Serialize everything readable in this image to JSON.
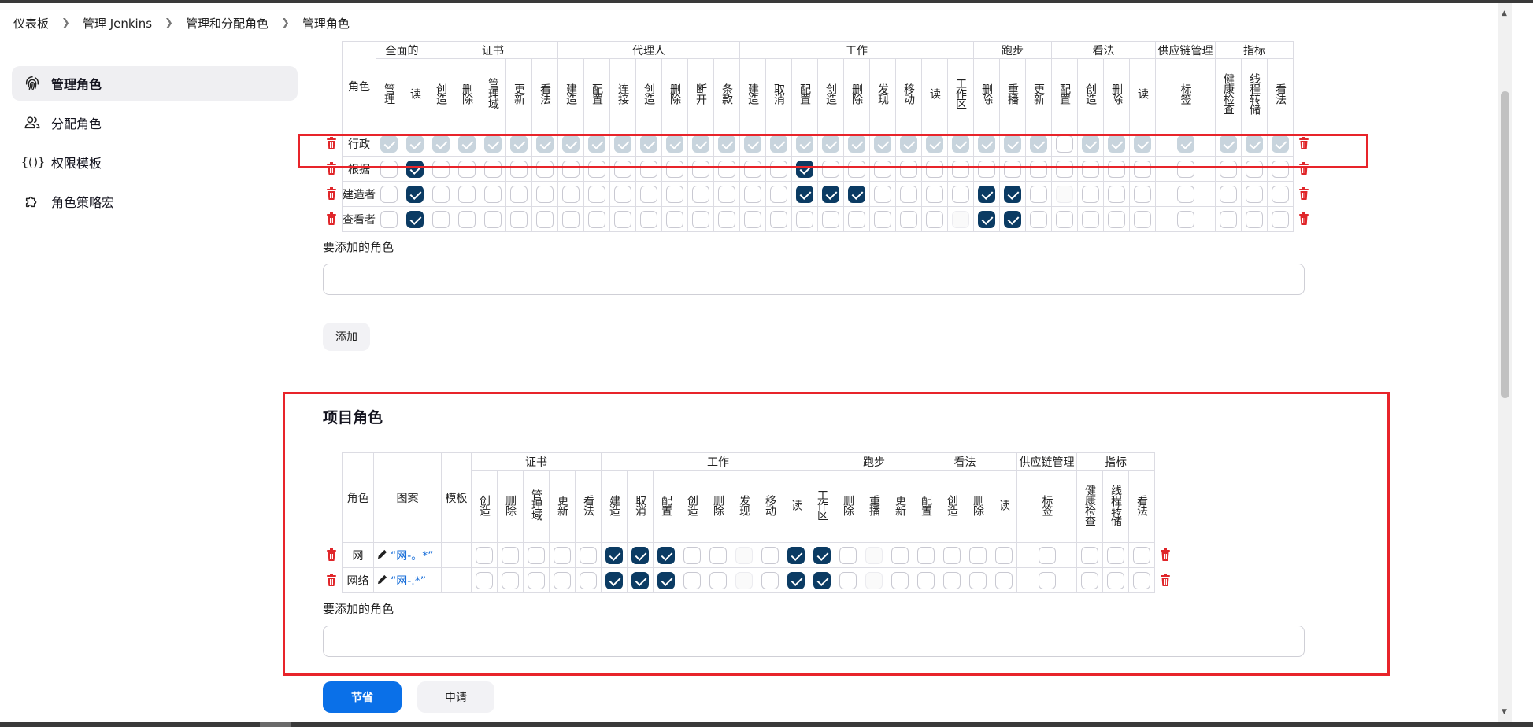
{
  "breadcrumb": [
    "仪表板",
    "管理 Jenkins",
    "管理和分配角色",
    "管理角色"
  ],
  "sidebar": {
    "items": [
      {
        "label": "管理角色",
        "icon": "fingerprint-icon",
        "active": true
      },
      {
        "label": "分配角色",
        "icon": "users-icon",
        "active": false
      },
      {
        "label": "权限模板",
        "icon": "braces-icon",
        "active": false
      },
      {
        "label": "角色策略宏",
        "icon": "puzzle-icon",
        "active": false
      }
    ]
  },
  "global": {
    "role_header": "角色",
    "groups": [
      {
        "name": "全面的",
        "perms": [
          "管理",
          "读"
        ]
      },
      {
        "name": "证书",
        "perms": [
          "创造",
          "删除",
          "管理域",
          "更新",
          "看法"
        ]
      },
      {
        "name": "代理人",
        "perms": [
          "建造",
          "配置",
          "连接",
          "创造",
          "删除",
          "断开",
          "条款"
        ]
      },
      {
        "name": "工作",
        "perms": [
          "建造",
          "取消",
          "配置",
          "创造",
          "删除",
          "发现",
          "移动",
          "读",
          "工作区"
        ]
      },
      {
        "name": "跑步",
        "perms": [
          "删除",
          "重播",
          "更新"
        ]
      },
      {
        "name": "看法",
        "perms": [
          "配置",
          "创造",
          "删除",
          "读"
        ]
      },
      {
        "name": "供应链管理",
        "perms": [
          "标签"
        ]
      },
      {
        "name": "指标",
        "perms": [
          "健康检查",
          "线程转储",
          "看法"
        ]
      }
    ],
    "rows": [
      {
        "name": "行政",
        "state": "dddddddddddddddddddddddddd_dddddddd"
      },
      {
        "name": "根据",
        "state": "_x______________x__________________"
      },
      {
        "name": "建造者",
        "state": "_x______________xxx____xx_f________"
      },
      {
        "name": "查看者",
        "state": "_x____________________fxx_________"
      }
    ],
    "add_label": "要添加的角色",
    "add_placeholder": "",
    "add_button": "添加"
  },
  "project": {
    "heading": "项目角色",
    "role_header": "角色",
    "pattern_header": "图案",
    "template_header": "模板",
    "groups": [
      {
        "name": "证书",
        "perms": [
          "创造",
          "删除",
          "管理域",
          "更新",
          "看法"
        ]
      },
      {
        "name": "工作",
        "perms": [
          "建造",
          "取消",
          "配置",
          "创造",
          "删除",
          "发现",
          "移动",
          "读",
          "工作区"
        ]
      },
      {
        "name": "跑步",
        "perms": [
          "删除",
          "重播",
          "更新"
        ]
      },
      {
        "name": "看法",
        "perms": [
          "配置",
          "创造",
          "删除",
          "读"
        ]
      },
      {
        "name": "供应链管理",
        "perms": [
          "标签"
        ]
      },
      {
        "name": "指标",
        "perms": [
          "健康检查",
          "线程转储",
          "看法"
        ]
      }
    ],
    "rows": [
      {
        "name": "网",
        "pattern": "“网-。*”",
        "state": "_____xxx__f_xx_f_________"
      },
      {
        "name": "网络",
        "pattern": "“网-.*”",
        "state": "_____xxx__f_xx_f_________"
      }
    ],
    "add_label": "要添加的角色",
    "add_placeholder": ""
  },
  "footer": {
    "save": "节省",
    "apply": "申请"
  },
  "colors": {
    "accent": "#0a70e8",
    "checked": "#0b3b63",
    "highlight": "#e8242a",
    "delete": "#e0262a"
  }
}
